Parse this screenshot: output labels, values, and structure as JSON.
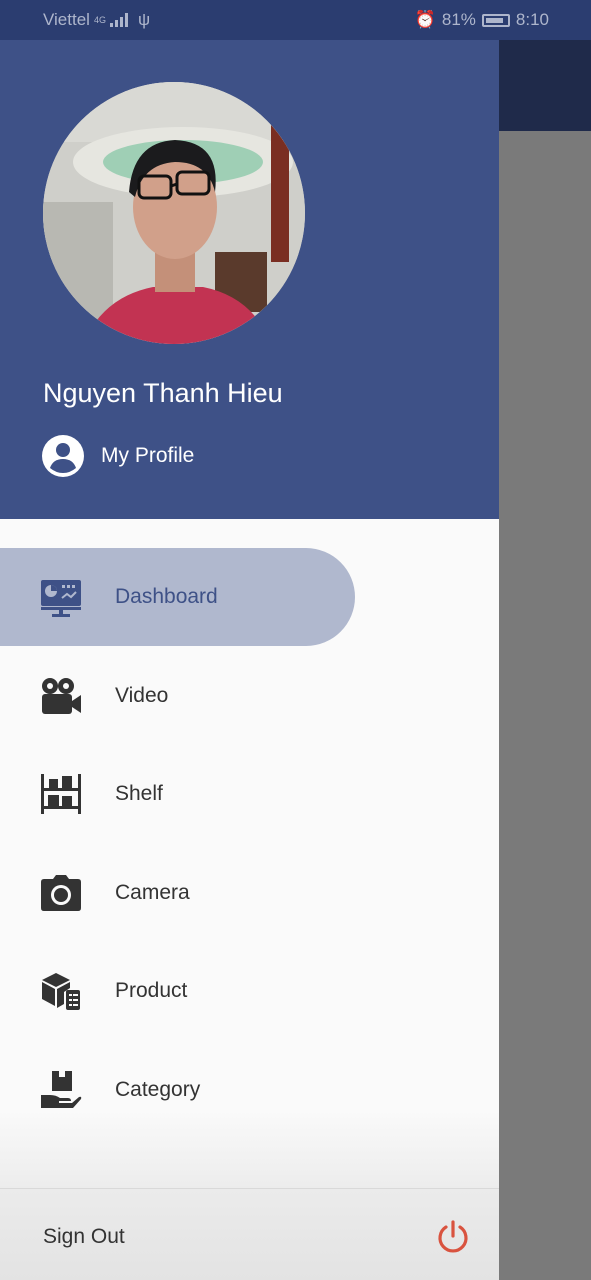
{
  "status_bar": {
    "carrier": "Viettel",
    "network": "4G",
    "battery": "81%",
    "time": "8:10"
  },
  "header": {
    "user_name": "Nguyen Thanh Hieu",
    "profile_label": "My Profile"
  },
  "menu": {
    "items": [
      {
        "label": "Dashboard",
        "icon": "dashboard-icon",
        "active": true
      },
      {
        "label": "Video",
        "icon": "video-camera-icon",
        "active": false
      },
      {
        "label": "Shelf",
        "icon": "shelf-icon",
        "active": false
      },
      {
        "label": "Camera",
        "icon": "camera-icon",
        "active": false
      },
      {
        "label": "Product",
        "icon": "product-icon",
        "active": false
      },
      {
        "label": "Category",
        "icon": "category-icon",
        "active": false
      }
    ]
  },
  "footer": {
    "signout_label": "Sign Out"
  },
  "colors": {
    "primary": "#3e5187",
    "active_bg": "#b0b8ce",
    "signout_icon": "#d9533f"
  }
}
